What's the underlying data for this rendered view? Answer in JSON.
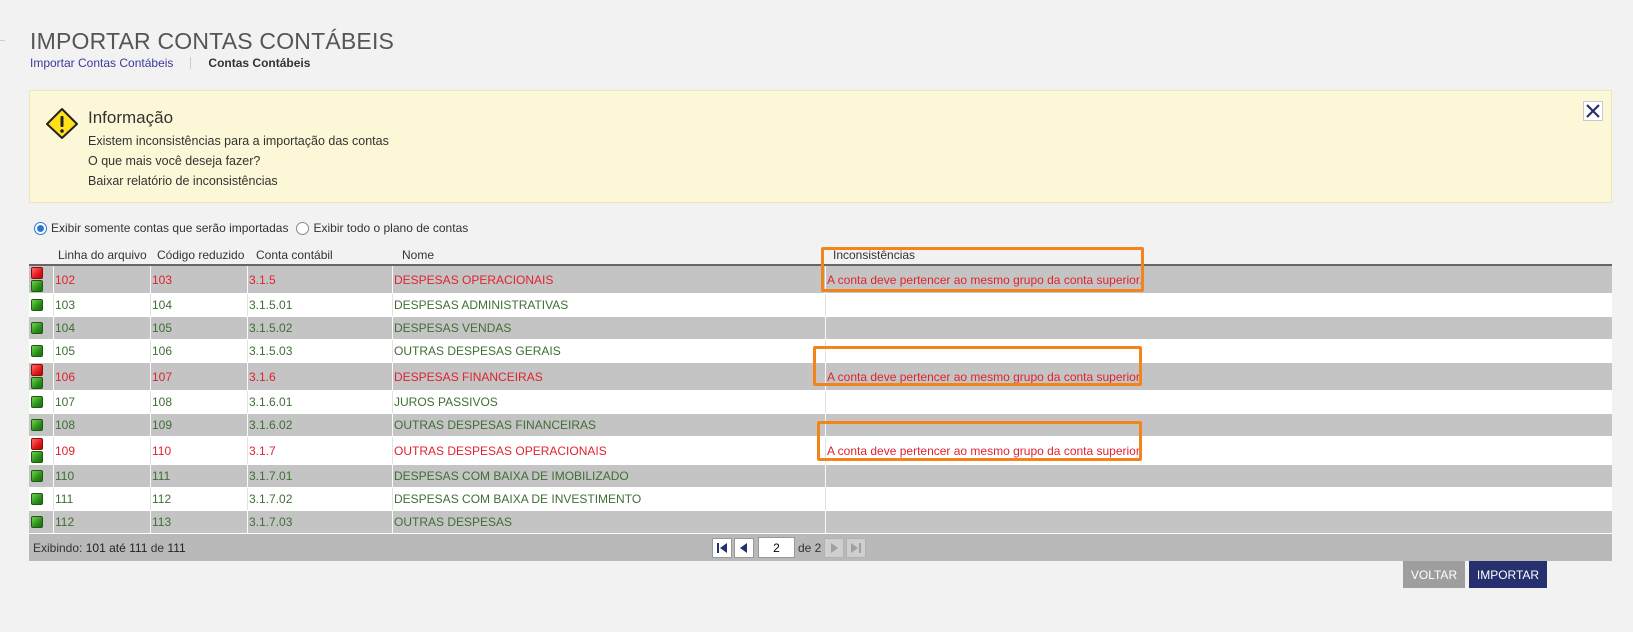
{
  "page": {
    "title": "IMPORTAR CONTAS CONTÁBEIS"
  },
  "breadcrumb": {
    "link": "Importar Contas Contábeis",
    "current": "Contas Contábeis"
  },
  "info": {
    "title": "Informação",
    "line1": "Existem inconsistências para a importação das contas",
    "line2": "O que mais você deseja fazer?",
    "line3": "Baixar relatório de inconsistências",
    "icon": "warning-icon",
    "close_icon": "close-icon"
  },
  "filters": {
    "option1": "Exibir somente contas que serão importadas",
    "option2": "Exibir todo o plano de contas",
    "selected": 1
  },
  "grid": {
    "headers": {
      "line": "Linha do arquivo",
      "code": "Código reduzido",
      "account": "Conta contábil",
      "name": "Nome",
      "issues": "Inconsistências"
    },
    "rows": [
      {
        "line": "102",
        "code": "103",
        "account": "3.1.5",
        "name": "DESPESAS OPERACIONAIS",
        "issue": "A conta deve pertencer ao mesmo grupo da conta superior.",
        "status": "error"
      },
      {
        "line": "103",
        "code": "104",
        "account": "3.1.5.01",
        "name": "DESPESAS ADMINISTRATIVAS",
        "issue": "",
        "status": "ok"
      },
      {
        "line": "104",
        "code": "105",
        "account": "3.1.5.02",
        "name": "DESPESAS VENDAS",
        "issue": "",
        "status": "ok"
      },
      {
        "line": "105",
        "code": "106",
        "account": "3.1.5.03",
        "name": "OUTRAS DESPESAS GERAIS",
        "issue": "",
        "status": "ok"
      },
      {
        "line": "106",
        "code": "107",
        "account": "3.1.6",
        "name": "DESPESAS FINANCEIRAS",
        "issue": "A conta deve pertencer ao mesmo grupo da conta superior.",
        "status": "error"
      },
      {
        "line": "107",
        "code": "108",
        "account": "3.1.6.01",
        "name": "JUROS PASSIVOS",
        "issue": "",
        "status": "ok"
      },
      {
        "line": "108",
        "code": "109",
        "account": "3.1.6.02",
        "name": "OUTRAS DESPESAS FINANCEIRAS",
        "issue": "",
        "status": "ok"
      },
      {
        "line": "109",
        "code": "110",
        "account": "3.1.7",
        "name": "OUTRAS DESPESAS OPERACIONAIS",
        "issue": "A conta deve pertencer ao mesmo grupo da conta superior.",
        "status": "error"
      },
      {
        "line": "110",
        "code": "111",
        "account": "3.1.7.01",
        "name": "DESPESAS COM BAIXA DE IMOBILIZADO",
        "issue": "",
        "status": "ok"
      },
      {
        "line": "111",
        "code": "112",
        "account": "3.1.7.02",
        "name": "DESPESAS COM BAIXA DE INVESTIMENTO",
        "issue": "",
        "status": "ok"
      },
      {
        "line": "112",
        "code": "113",
        "account": "3.1.7.03",
        "name": "OUTRAS DESPESAS",
        "issue": "",
        "status": "ok"
      }
    ]
  },
  "pagination": {
    "showing_label": "Exibindo:",
    "from": "101",
    "until_label": "até",
    "to": "111",
    "of_label": "de",
    "total": "111",
    "current_page": "2",
    "pages_label": "de 2"
  },
  "actions": {
    "back": "VOLTAR",
    "import": "IMPORTAR"
  },
  "colors": {
    "error": "#e0232f",
    "ok": "#3f6f35",
    "highlight": "#f3841b",
    "primary": "#27306e"
  }
}
